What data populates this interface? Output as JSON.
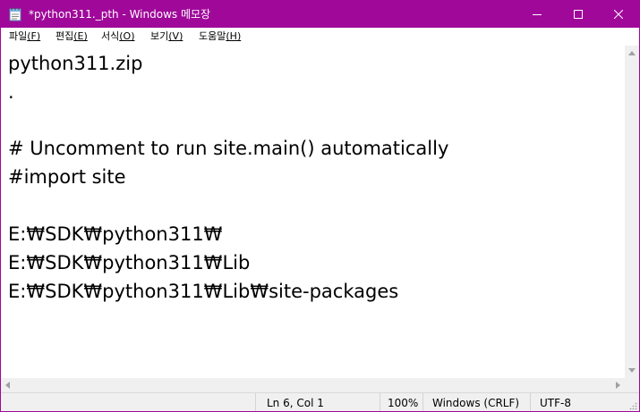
{
  "titlebar": {
    "title": "*python311._pth - Windows 메모장",
    "colors": {
      "background": "#a0089a",
      "text": "#ffffff"
    },
    "icons": [
      "notepad-icon",
      "minimize-icon",
      "maximize-icon",
      "close-icon"
    ]
  },
  "menu": {
    "items": [
      {
        "label": "파일",
        "accel": "(F)"
      },
      {
        "label": "편집",
        "accel": "(E)"
      },
      {
        "label": "서식",
        "accel": "(O)"
      },
      {
        "label": "보기",
        "accel": "(V)"
      },
      {
        "label": "도움말",
        "accel": "(H)"
      }
    ]
  },
  "editor": {
    "lines": [
      "python311.zip",
      ".",
      "",
      "# Uncomment to run site.main() automatically",
      "#import site",
      "",
      "E:₩SDK₩python311₩",
      "E:₩SDK₩python311₩Lib",
      "E:₩SDK₩python311₩Lib₩site-packages"
    ]
  },
  "statusbar": {
    "position": "Ln 6, Col 1",
    "zoom": "100%",
    "line_ending": "Windows (CRLF)",
    "encoding": "UTF-8"
  }
}
